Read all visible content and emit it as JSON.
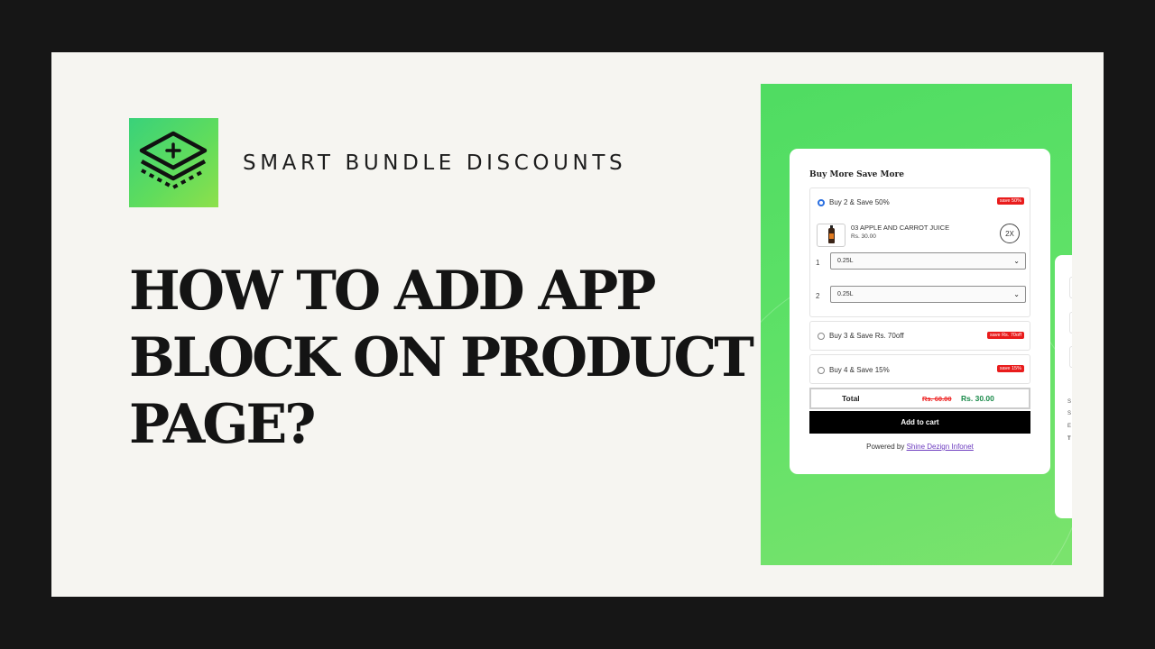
{
  "brand": {
    "name": "SMART BUNDLE DISCOUNTS",
    "logo_icon": "stacked-layers-plus-icon",
    "colors": {
      "green_start": "#39d27a",
      "green_end": "#8ee04b"
    }
  },
  "headline": [
    "HOW TO ADD APP",
    "BLOCK ON PRODUCT",
    "PAGE?"
  ],
  "widget": {
    "title": "Buy More Save More",
    "options": [
      {
        "label": "Buy 2 & Save 50%",
        "badge": "save 50%",
        "selected": true,
        "product": {
          "name": "03 APPLE AND CARROT JUICE",
          "price": "Rs. 30.00",
          "quantity": "2X"
        },
        "variants": [
          {
            "index": "1",
            "value": "0.25L"
          },
          {
            "index": "2",
            "value": "0.25L"
          }
        ]
      },
      {
        "label": "Buy 3 & Save Rs. 70off",
        "badge": "save Rs. 70off",
        "selected": false
      },
      {
        "label": "Buy 4 & Save 15%",
        "badge": "save 15%",
        "selected": false
      }
    ],
    "total": {
      "label": "Total",
      "old_price": "Rs. 60.00",
      "new_price": "Rs. 30.00"
    },
    "add_to_cart": "Add to cart",
    "powered_by": {
      "prefix": "Powered by",
      "link": "Shine Dezign Infonet"
    },
    "colors": {
      "badge": "#e91c1c",
      "accent_green": "#1a8a4a",
      "old_price": "#ee2222",
      "link": "#6c3bbf"
    }
  },
  "side_panel_letters": [
    "S",
    "S",
    "E",
    "T"
  ]
}
